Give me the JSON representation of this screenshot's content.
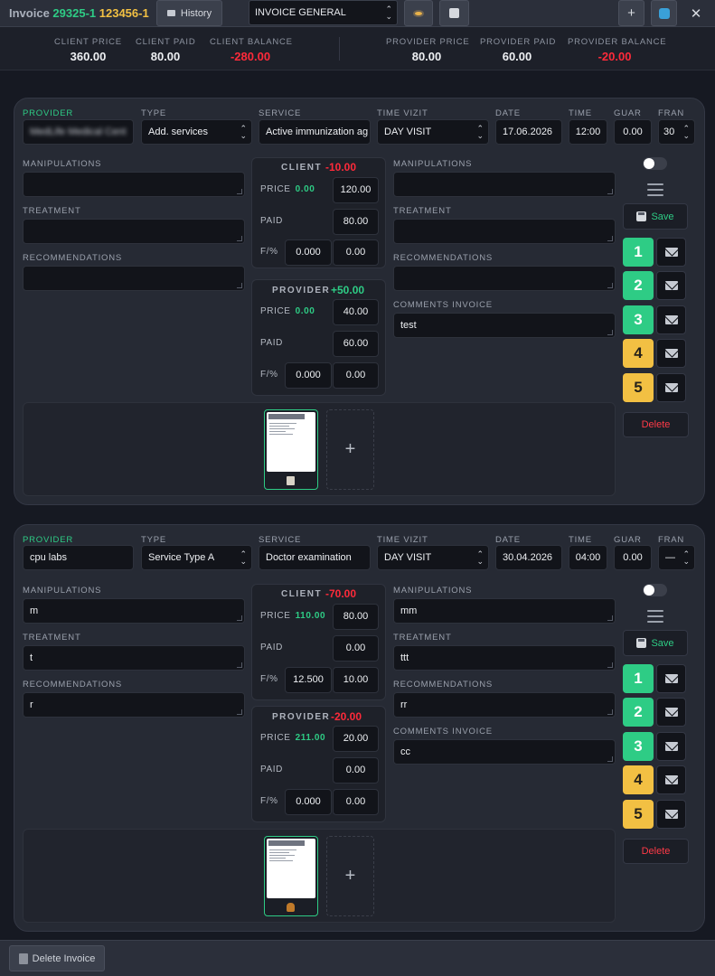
{
  "header": {
    "title_prefix": "Invoice",
    "invoice_no": "29325-1",
    "patient_no": "123456-1",
    "history_label": "History",
    "view_select": "INVOICE GENERAL"
  },
  "summary": {
    "client_price": {
      "label": "CLIENT PRICE",
      "value": "360.00"
    },
    "client_paid": {
      "label": "CLIENT PAID",
      "value": "80.00"
    },
    "client_balance": {
      "label": "CLIENT BALANCE",
      "value": "-280.00"
    },
    "provider_price": {
      "label": "PROVIDER PRICE",
      "value": "80.00"
    },
    "provider_paid": {
      "label": "PROVIDER PAID",
      "value": "60.00"
    },
    "provider_balance": {
      "label": "PROVIDER BALANCE",
      "value": "-20.00"
    }
  },
  "labels": {
    "provider": "PROVIDER",
    "type": "TYPE",
    "service": "SERVICE",
    "time_vizit": "TIME VIZIT",
    "date": "DATE",
    "time": "TIME",
    "guar": "GUAR",
    "fran": "FRAN",
    "manipulations": "MANIPULATIONS",
    "treatment": "TREATMENT",
    "recommendations": "RECOMMENDATIONS",
    "comments_invoice": "COMMENTS INVOICE",
    "client": "CLIENT",
    "provider_box": "PROVIDER",
    "price": "PRICE",
    "paid": "PAID",
    "fpct": "F/%",
    "save": "Save",
    "delete": "Delete",
    "delete_invoice": "Delete Invoice",
    "add_file": "+"
  },
  "services": [
    {
      "provider": "MedLife Medical Cent",
      "type": "Add. services",
      "service": "Active immunization ag",
      "time_vizit": "DAY VISIT",
      "date": "17.06.2026",
      "time": "12:00",
      "guar": "0.00",
      "fran": "30",
      "left": {
        "manipulations": "",
        "treatment": "",
        "recommendations": ""
      },
      "right": {
        "manipulations": "",
        "treatment": "",
        "recommendations": "",
        "comments": "test"
      },
      "client": {
        "balance": "-10.00",
        "price_hint": "0.00",
        "price": "120.00",
        "paid": "80.00",
        "f_pct": "0.000",
        "f_val": "0.00"
      },
      "provider_box": {
        "balance": "+50.00",
        "price_hint": "0.00",
        "price": "40.00",
        "paid": "60.00",
        "f_pct": "0.000",
        "f_val": "0.00"
      },
      "buttons": [
        "1",
        "2",
        "3",
        "4",
        "5"
      ]
    },
    {
      "provider": "cpu labs",
      "type": "Service Type A",
      "service": "Doctor examination",
      "time_vizit": "DAY VISIT",
      "date": "30.04.2026",
      "time": "04:00",
      "guar": "0.00",
      "fran": "—",
      "left": {
        "manipulations": "m",
        "treatment": "t",
        "recommendations": "r"
      },
      "right": {
        "manipulations": "mm",
        "treatment": "ttt",
        "recommendations": "rr",
        "comments": "cc"
      },
      "client": {
        "balance": "-70.00",
        "price_hint": "110.00",
        "price": "80.00",
        "paid": "0.00",
        "f_pct": "12.500",
        "f_val": "10.00"
      },
      "provider_box": {
        "balance": "-20.00",
        "price_hint": "211.00",
        "price": "20.00",
        "paid": "0.00",
        "f_pct": "0.000",
        "f_val": "0.00"
      },
      "buttons": [
        "1",
        "2",
        "3",
        "4",
        "5"
      ]
    }
  ],
  "colors": {
    "green": "#2ecc85",
    "yellow": "#f2c043",
    "red": "#ff2a3a"
  },
  "icons": [
    "mail-icon",
    "eye-icon",
    "save-icon",
    "plus-icon",
    "refresh-icon",
    "close-icon",
    "trash-icon",
    "menu-icon"
  ]
}
